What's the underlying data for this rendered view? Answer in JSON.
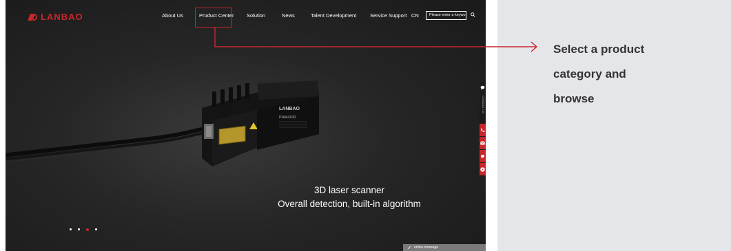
{
  "header": {
    "logo_text": "LANBAO",
    "nav_items": [
      "About Us",
      "Product Center",
      "Solution",
      "News",
      "Talent Development",
      "Service Support",
      "CN"
    ],
    "search_placeholder": "Please enter a keyword"
  },
  "hero": {
    "device_brand": "LANBAO",
    "device_model": "PHM4100",
    "title": "3D laser scanner",
    "subtitle": "Overall detection, built-in algorithm",
    "slide_count": 4,
    "active_slide": 3
  },
  "sidebar": {
    "contact_label": "CONTACT US"
  },
  "footer": {
    "online_message_label": "online message"
  },
  "annotation": {
    "lines": [
      "Select a product",
      "category and",
      "browse"
    ]
  },
  "colors": {
    "brand_red": "#c8262b",
    "hero_background": "#262626",
    "panel_background": "#e5e6e9"
  }
}
